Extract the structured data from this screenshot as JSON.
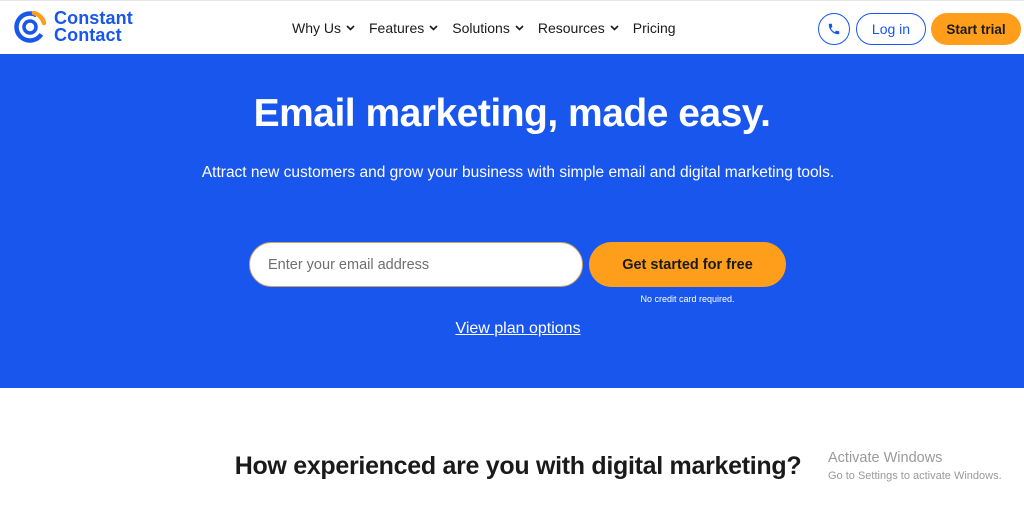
{
  "brand": {
    "name_line1": "Constant",
    "name_line2": "Contact",
    "color": "#1856ed",
    "accent": "#ff9e1b",
    "logo_icon": "constant-contact-logo-icon"
  },
  "nav": {
    "items": [
      {
        "label": "Why Us",
        "has_dropdown": true
      },
      {
        "label": "Features",
        "has_dropdown": true
      },
      {
        "label": "Solutions",
        "has_dropdown": true
      },
      {
        "label": "Resources",
        "has_dropdown": true
      },
      {
        "label": "Pricing",
        "has_dropdown": false
      }
    ]
  },
  "header_actions": {
    "phone_icon": "phone-icon",
    "login_label": "Log in",
    "trial_label": "Start trial"
  },
  "hero": {
    "title": "Email marketing, made easy.",
    "subtitle": "Attract new customers and grow your business with simple email and digital marketing tools.",
    "email_placeholder": "Enter your email address",
    "email_value": "",
    "cta_label": "Get started for free",
    "no_cc_note": "No credit card required.",
    "plan_link": "View plan options",
    "background": "#1856ed"
  },
  "section": {
    "title": "How experienced are you with digital marketing?"
  },
  "os_watermark": {
    "title": "Activate Windows",
    "subtitle": "Go to Settings to activate Windows."
  }
}
